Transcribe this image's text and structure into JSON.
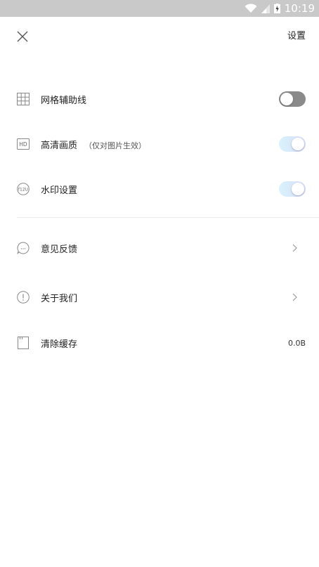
{
  "status_bar": {
    "time": "10:19"
  },
  "header": {
    "title": "设置"
  },
  "settings": {
    "grid_lines": {
      "label": "网格辅助线",
      "icon": "grid-icon",
      "enabled": false
    },
    "hd_quality": {
      "label": "高清画质",
      "note": "（仅对图片生效）",
      "icon_text": "HD",
      "enabled": true
    },
    "watermark": {
      "label": "水印设置",
      "icon_text": "f12U",
      "enabled": true
    },
    "feedback": {
      "label": "意见反馈",
      "icon": "chat-bubble-icon"
    },
    "about": {
      "label": "关于我们",
      "icon": "info-circle-icon"
    },
    "clear_cache": {
      "label": "清除缓存",
      "icon": "storage-card-icon",
      "value": "0.0B"
    }
  },
  "colors": {
    "status_bar_bg": "#c9c9c9",
    "toggle_off": "#8a8a8a",
    "toggle_on_start": "#d9f3fb",
    "toggle_on_end": "#d8dcfa"
  }
}
